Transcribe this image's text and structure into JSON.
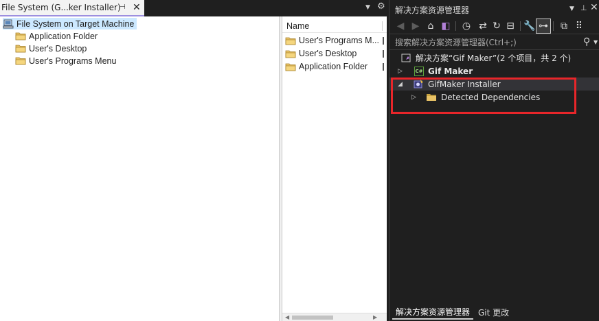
{
  "document_tab": {
    "title": "File System (G...ker Installer)"
  },
  "fs_tree": {
    "root": "File System on Target Machine",
    "items": [
      {
        "label": "Application Folder"
      },
      {
        "label": "User's Desktop"
      },
      {
        "label": "User's Programs Menu"
      }
    ]
  },
  "fs_list": {
    "column_name": "Name",
    "items": [
      {
        "label": "User's Programs M..."
      },
      {
        "label": "User's Desktop"
      },
      {
        "label": "Application Folder"
      }
    ]
  },
  "solution_explorer": {
    "title": "解决方案资源管理器",
    "search_placeholder": "搜索解决方案资源管理器(Ctrl+;)",
    "solution_label": "解决方案“Gif Maker”(2 个项目，共 2 个)",
    "project_gifmaker": "Gif Maker",
    "project_installer": "GifMaker Installer",
    "detected_dependencies": "Detected Dependencies",
    "csharp_badge": "C#",
    "bottom_tabs": [
      "解决方案资源管理器",
      "Git 更改"
    ]
  },
  "colors": {
    "highlight": "#e8262a",
    "selection": "#333337",
    "tree_selection": "#cce8ff",
    "accent": "#9d8fe0"
  }
}
